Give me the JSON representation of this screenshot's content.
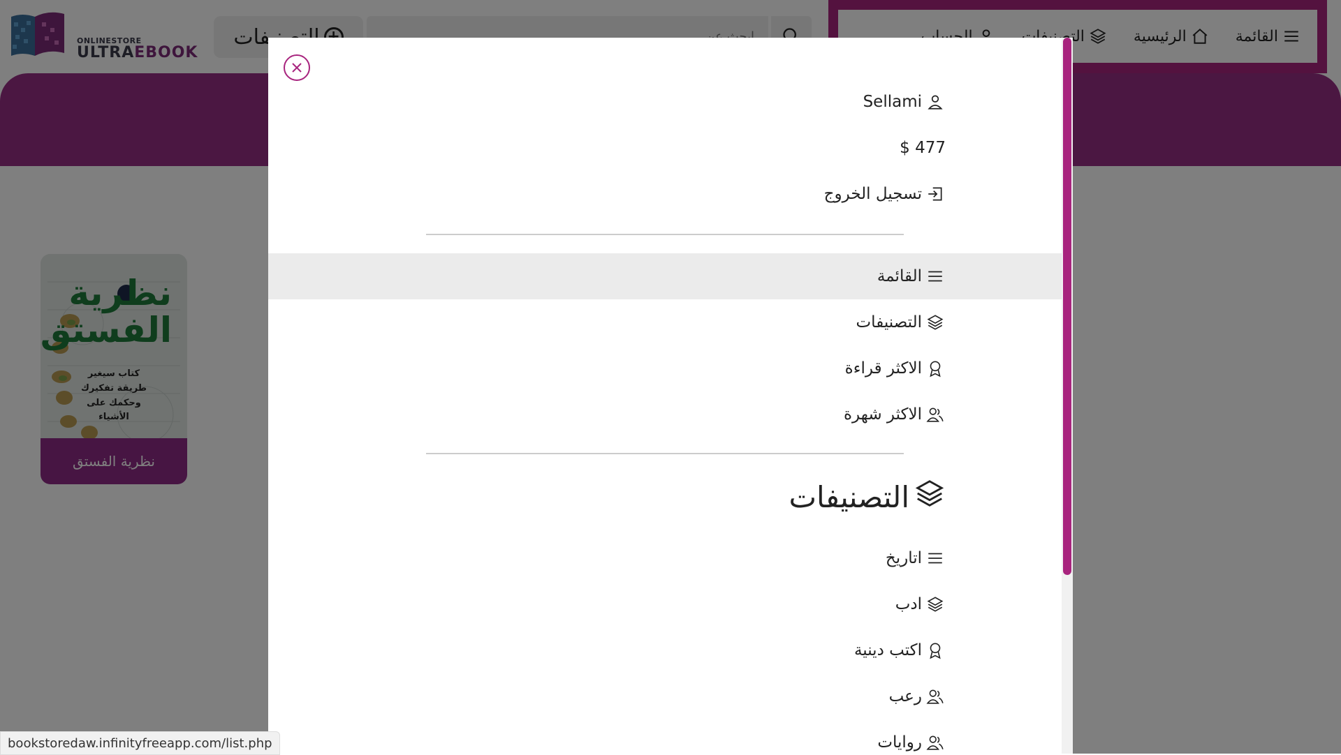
{
  "header": {
    "logo": {
      "small_text": "ONLINESTORE",
      "big_text_a": "ULTRA",
      "big_text_b": "EBOOK"
    },
    "categories_button": "التصنيفات",
    "search": {
      "placeholder": "ابحث عن..."
    },
    "nav": [
      {
        "label": "القائمة",
        "icon": "menu-icon"
      },
      {
        "label": "الرئيسية",
        "icon": "home-icon"
      },
      {
        "label": "التصنيفات",
        "icon": "layers-icon"
      },
      {
        "label": "الحساب",
        "icon": "user-icon"
      }
    ]
  },
  "book": {
    "cover_title": "نظرية الفستق",
    "cover_subtitle": "كتاب سيغير طريقة تفكيرك وحكمك على الأشياء",
    "caption": "نظرية الفستق"
  },
  "menu": {
    "user": {
      "name": "Sellami",
      "balance": "477 $",
      "logout": "تسجيل الخروج"
    },
    "links": [
      {
        "label": "القائمة",
        "icon": "menu-icon"
      },
      {
        "label": "التصنيفات",
        "icon": "layers-icon"
      },
      {
        "label": "الاكثر قراءة",
        "icon": "award-icon"
      },
      {
        "label": "الاكثر شهرة",
        "icon": "users-icon"
      }
    ],
    "categories_title": "التصنيفات",
    "categories": [
      {
        "label": "اتاريخ",
        "icon": "menu-icon"
      },
      {
        "label": "ادب",
        "icon": "layers-icon"
      },
      {
        "label": "اكتب دينية",
        "icon": "award-icon"
      },
      {
        "label": "رعب",
        "icon": "users-icon"
      },
      {
        "label": "روايات",
        "icon": "users-icon"
      }
    ]
  },
  "status_bar": {
    "url": "bookstoredaw.infinityfreeapp.com/list.php"
  },
  "colors": {
    "accent": "#a8247e",
    "banner": "#962e84",
    "overlay": "rgba(0,0,0,0.5)"
  }
}
